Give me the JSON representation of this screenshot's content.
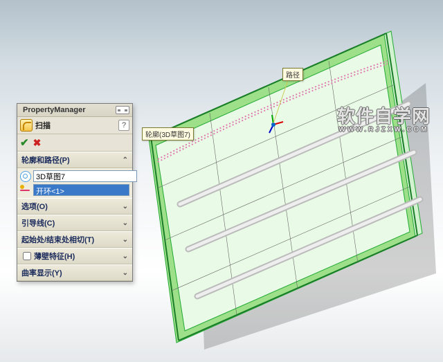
{
  "watermark": {
    "main": "软件自学网",
    "sub": "WWW.RJZXW.COM"
  },
  "pm": {
    "title": "PropertyManager",
    "feature_label": "扫描",
    "help": "?",
    "sections": {
      "profile_path": {
        "title": "轮廓和路径(P)",
        "profile_value": "3D草图7",
        "path_value": "开环<1>"
      },
      "options": {
        "title": "选项(O)"
      },
      "guides": {
        "title": "引导线(C)"
      },
      "tangency": {
        "title": "起始处/结束处相切(T)"
      },
      "thin": {
        "title": "薄壁特征(H)"
      },
      "curvature": {
        "title": "曲率显示(Y)"
      }
    }
  },
  "callouts": {
    "profile_label": "轮廓(3D草图7)",
    "path_label": "路径"
  }
}
